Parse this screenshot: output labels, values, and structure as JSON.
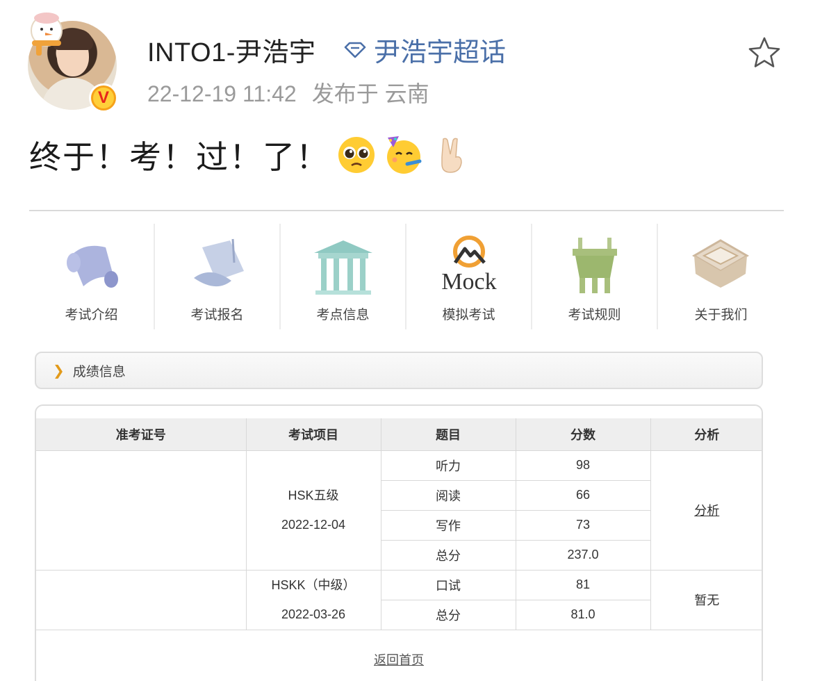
{
  "post": {
    "username": "INTO1-尹浩宇",
    "supertopic": "尹浩宇超话",
    "timestamp": "22-12-19 11:42",
    "location": "发布于 云南",
    "text": "终于！考！过！了！",
    "emojis": [
      "pleading-face",
      "partying-face",
      "victory-hand"
    ],
    "verified_badge": "V"
  },
  "icons": {
    "follow": "star-outline-icon",
    "supertopic": "diamond-icon"
  },
  "exam_site": {
    "nav": [
      {
        "label": "考试介绍",
        "icon": "scroll-icon"
      },
      {
        "label": "考试报名",
        "icon": "registration-scroll-icon"
      },
      {
        "label": "考点信息",
        "icon": "pavilion-icon"
      },
      {
        "label": "模拟考试",
        "icon": "mock-mountain-icon",
        "logo_text": "Mock"
      },
      {
        "label": "考试规则",
        "icon": "bronze-ding-icon"
      },
      {
        "label": "关于我们",
        "icon": "jade-seal-icon"
      }
    ],
    "section_title": "成绩信息",
    "table": {
      "headers": [
        "准考证号",
        "考试项目",
        "题目",
        "分数",
        "分析"
      ],
      "exams": [
        {
          "project": "HSK五级",
          "date": "2022-12-04",
          "analysis": "分析",
          "rows": [
            {
              "subject": "听力",
              "score": "98"
            },
            {
              "subject": "阅读",
              "score": "66"
            },
            {
              "subject": "写作",
              "score": "73"
            },
            {
              "subject": "总分",
              "score": "237.0"
            }
          ]
        },
        {
          "project": "HSKK（中级）",
          "date": "2022-03-26",
          "analysis": "暂无",
          "rows": [
            {
              "subject": "口试",
              "score": "81"
            },
            {
              "subject": "总分",
              "score": "81.0"
            }
          ]
        }
      ]
    },
    "back_link": "返回首页"
  },
  "colors": {
    "supertopic_blue": "#4a6fa8",
    "timestamp_gray": "#9a9a9a",
    "badge_orange": "#f6a21a",
    "badge_red": "#e8251b",
    "table_header_bg": "#eeeeee"
  }
}
